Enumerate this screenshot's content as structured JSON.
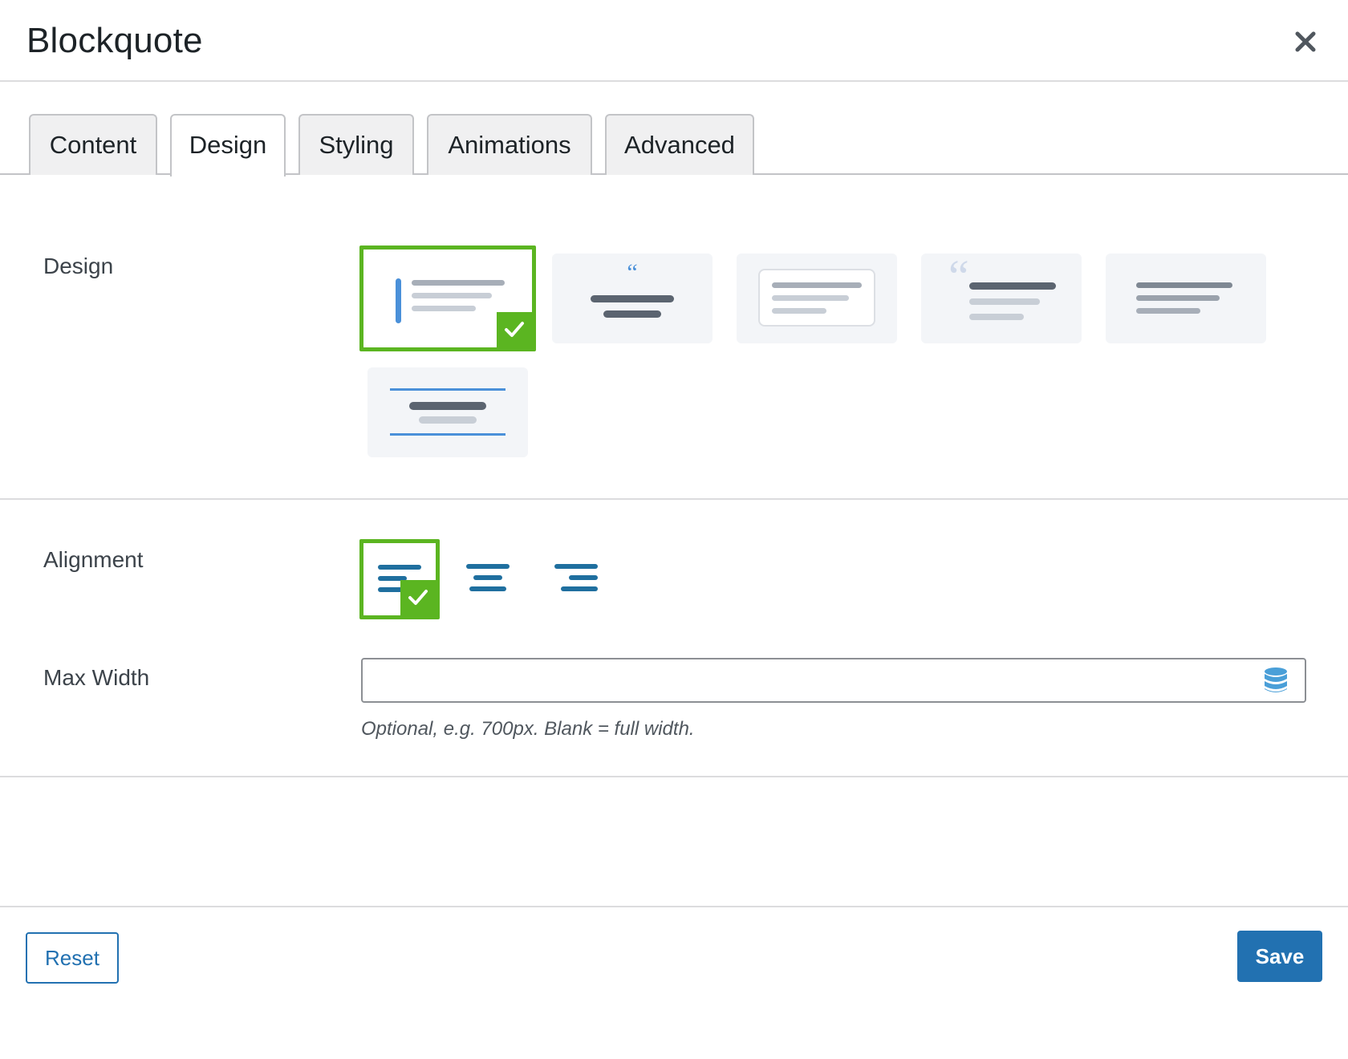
{
  "modal": {
    "title": "Blockquote",
    "close_icon": "close-icon"
  },
  "tabs": [
    {
      "label": "Content",
      "active": false
    },
    {
      "label": "Design",
      "active": true
    },
    {
      "label": "Styling",
      "active": false
    },
    {
      "label": "Animations",
      "active": false
    },
    {
      "label": "Advanced",
      "active": false
    }
  ],
  "design": {
    "label": "Design",
    "options": [
      {
        "name": "left-border",
        "selected": true
      },
      {
        "name": "centered-quote-mark",
        "selected": false
      },
      {
        "name": "boxed",
        "selected": false
      },
      {
        "name": "large-quote-mark",
        "selected": false
      },
      {
        "name": "plain",
        "selected": false
      },
      {
        "name": "top-bottom-rules",
        "selected": false
      }
    ]
  },
  "alignment": {
    "label": "Alignment",
    "options": [
      {
        "name": "left",
        "selected": true
      },
      {
        "name": "center",
        "selected": false
      },
      {
        "name": "right",
        "selected": false
      }
    ]
  },
  "max_width": {
    "label": "Max Width",
    "value": "",
    "placeholder": "",
    "helper": "Optional, e.g. 700px. Blank = full width.",
    "icon": "database-icon"
  },
  "footer": {
    "reset_label": "Reset",
    "save_label": "Save"
  },
  "colors": {
    "accent": "#2271b1",
    "selected": "#5bb521",
    "icon_blue": "#4a90d9"
  }
}
